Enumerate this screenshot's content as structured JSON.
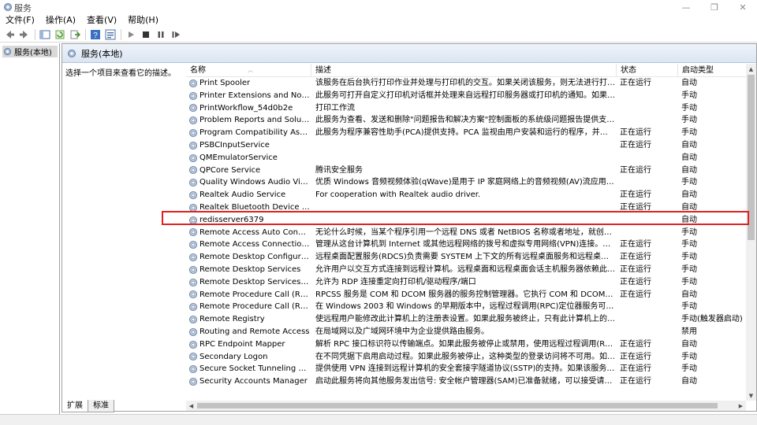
{
  "window": {
    "title": "服务"
  },
  "menu": [
    "文件(F)",
    "操作(A)",
    "查看(V)",
    "帮助(H)"
  ],
  "toolbar_icons": [
    "back-icon",
    "forward-icon",
    "up-icon",
    "list-view-icon",
    "refresh-icon",
    "export-icon",
    "help-icon",
    "properties-icon",
    "start-icon",
    "stop-icon",
    "pause-icon",
    "restart-icon"
  ],
  "tree": {
    "selected": "服务(本地)"
  },
  "header": {
    "title": "服务(本地)"
  },
  "desc_pane": {
    "text": "选择一个项目来查看它的描述。"
  },
  "columns": {
    "name": "名称",
    "desc": "描述",
    "status": "状态",
    "startup": "启动类型"
  },
  "rows": [
    {
      "name": "Print Spooler",
      "desc": "该服务在后台执行打印作业并处理与打印机的交互。如果关闭该服务，则无法进行打印或查看...",
      "status": "正在运行",
      "startup": "自动"
    },
    {
      "name": "Printer Extensions and Notificati...",
      "desc": "此服务可打开自定义打印机对话框并处理来自远程打印服务器或打印机的通知。如果你关闭此...",
      "status": "",
      "startup": "手动"
    },
    {
      "name": "PrintWorkflow_54d0b2e",
      "desc": "打印工作流",
      "status": "",
      "startup": "手动"
    },
    {
      "name": "Problem Reports and Solutions ...",
      "desc": "此服务为查看、发送和删除\"问题报告和解决方案\"控制面板的系统级问题报告提供支持。",
      "status": "",
      "startup": "手动"
    },
    {
      "name": "Program Compatibility Assistant ...",
      "desc": "此服务为程序兼容性助手(PCA)提供支持。PCA 监视由用户安装和运行的程序，并检测已知兼...",
      "status": "正在运行",
      "startup": "手动"
    },
    {
      "name": "PSBCInputService",
      "desc": "",
      "status": "正在运行",
      "startup": "自动"
    },
    {
      "name": "QMEmulatorService",
      "desc": "",
      "status": "",
      "startup": "自动"
    },
    {
      "name": "QPCore Service",
      "desc": "腾讯安全服务",
      "status": "正在运行",
      "startup": "自动"
    },
    {
      "name": "Quality Windows Audio Video Ex...",
      "desc": "优质 Windows 音频视频体验(qWave)是用于 IP 家庭网络上的音频视频(AV)流应用程序的网络...",
      "status": "",
      "startup": "手动"
    },
    {
      "name": "Realtek Audio Service",
      "desc": "For cooperation with Realtek audio driver.",
      "status": "正在运行",
      "startup": "自动"
    },
    {
      "name": "Realtek Bluetooth Device Mana...",
      "desc": "",
      "status": "正在运行",
      "startup": "自动"
    },
    {
      "name": "redisserver6379",
      "desc": "",
      "status": "",
      "startup": "自动"
    },
    {
      "name": "Remote Access Auto Connectio...",
      "desc": "无论什么时候，当某个程序引用一个远程 DNS 或者 NetBIOS 名称或者地址，就创建一个到远...",
      "status": "",
      "startup": "手动"
    },
    {
      "name": "Remote Access Connection Man...",
      "desc": "管理从这台计算机到 Internet 或其他远程网络的拨号和虚拟专用网络(VPN)连接。如果禁用该...",
      "status": "正在运行",
      "startup": "手动"
    },
    {
      "name": "Remote Desktop Configuration",
      "desc": "远程桌面配置服务(RDCS)负责需要 SYSTEM 上下文的所有远程桌面服务和远程桌面相关的配...",
      "status": "正在运行",
      "startup": "手动"
    },
    {
      "name": "Remote Desktop Services",
      "desc": "允许用户以交互方式连接到远程计算机。远程桌面和远程桌面会话主机服务器依赖此服务。若...",
      "status": "正在运行",
      "startup": "手动"
    },
    {
      "name": "Remote Desktop Services User...",
      "desc": "允许为 RDP 连接重定向打印机/驱动程序/端口",
      "status": "正在运行",
      "startup": "手动"
    },
    {
      "name": "Remote Procedure Call (RPC)",
      "desc": "RPCSS 服务是 COM 和 DCOM 服务器的服务控制管理器。它执行 COM 和 DCOM 服务器的...",
      "status": "正在运行",
      "startup": "自动"
    },
    {
      "name": "Remote Procedure Call (RPC) Lo...",
      "desc": "在 Windows 2003 和 Windows 的早期版本中，远程过程调用(RPC)定位器服务可管理 RPC 名...",
      "status": "",
      "startup": "手动"
    },
    {
      "name": "Remote Registry",
      "desc": "使远程用户能修改此计算机上的注册表设置。如果此服务被终止，只有此计算机上的用户才能...",
      "status": "",
      "startup": "手动(触发器启动)"
    },
    {
      "name": "Routing and Remote Access",
      "desc": "在局域网以及广域网环境中为企业提供路由服务。",
      "status": "",
      "startup": "禁用"
    },
    {
      "name": "RPC Endpoint Mapper",
      "desc": "解析 RPC 接口标识符以传输端点。如果此服务被停止或禁用，使用远程过程调用(RPC)服务的...",
      "status": "正在运行",
      "startup": "自动"
    },
    {
      "name": "Secondary Logon",
      "desc": "在不同凭据下启用启动过程。如果此服务被停止，这种类型的登录访问将不可用。如果此服务...",
      "status": "正在运行",
      "startup": "手动"
    },
    {
      "name": "Secure Socket Tunneling Protoc...",
      "desc": "提供使用 VPN 连接到远程计算机的安全套接字隧道协议(SSTP)的支持。如果该服务被禁用，...",
      "status": "正在运行",
      "startup": "手动"
    },
    {
      "name": "Security Accounts Manager",
      "desc": "启动此服务将向其他服务发出信号: 安全帐户管理器(SAM)已准备就绪，可以接受请求。禁用...",
      "status": "正在运行",
      "startup": "自动"
    }
  ],
  "tabs": [
    "扩展",
    "标准"
  ],
  "colors": {
    "highlight_border": "#e02020",
    "selected_tree": "#d9d9d9"
  }
}
